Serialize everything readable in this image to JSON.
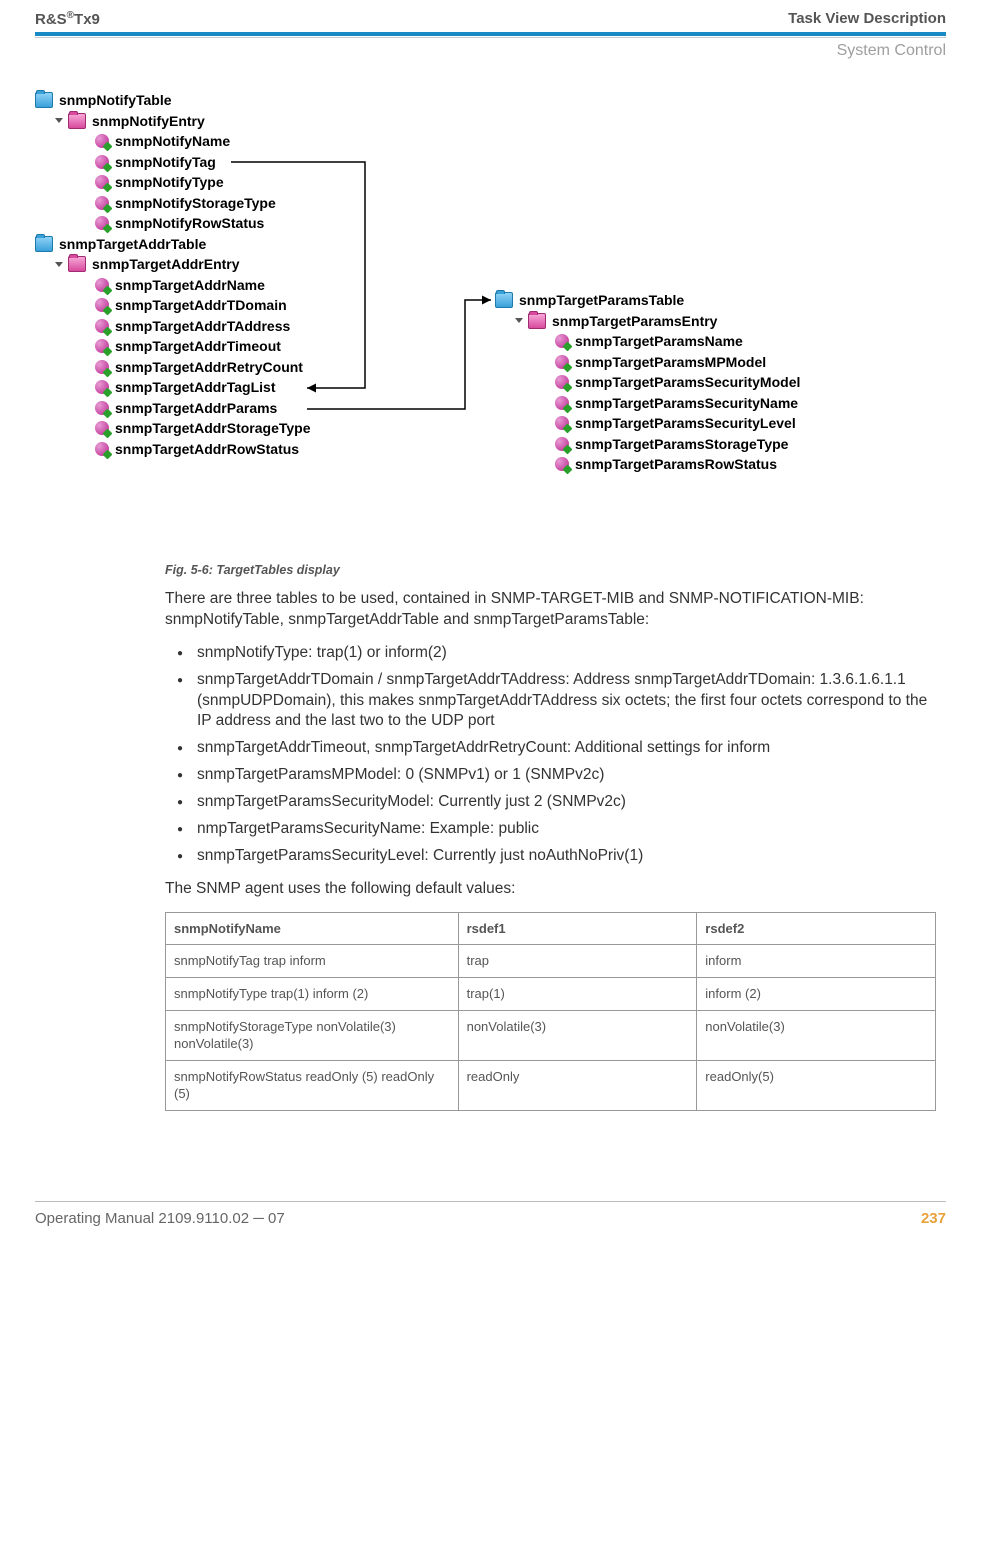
{
  "header": {
    "left_brand": "R&S",
    "left_sup": "®",
    "left_model": "Tx9",
    "right": "Task View Description",
    "sub": "System Control"
  },
  "diagram": {
    "left_tree": [
      {
        "level": 0,
        "icon": "folder-blue",
        "label": "snmpNotifyTable",
        "name": "snmpNotifyTable"
      },
      {
        "level": 1,
        "icon": "folder-pink",
        "label": "snmpNotifyEntry",
        "name": "snmpNotifyEntry",
        "expanded": true
      },
      {
        "level": 2,
        "icon": "leaf",
        "label": "snmpNotifyName",
        "name": "snmpNotifyName"
      },
      {
        "level": 2,
        "icon": "leaf",
        "label": "snmpNotifyTag",
        "name": "snmpNotifyTag"
      },
      {
        "level": 2,
        "icon": "leaf",
        "label": "snmpNotifyType",
        "name": "snmpNotifyType"
      },
      {
        "level": 2,
        "icon": "leaf",
        "label": "snmpNotifyStorageType",
        "name": "snmpNotifyStorageType"
      },
      {
        "level": 2,
        "icon": "leaf",
        "label": "snmpNotifyRowStatus",
        "name": "snmpNotifyRowStatus"
      },
      {
        "level": 0,
        "icon": "folder-blue",
        "label": "snmpTargetAddrTable",
        "name": "snmpTargetAddrTable"
      },
      {
        "level": 1,
        "icon": "folder-pink",
        "label": "snmpTargetAddrEntry",
        "name": "snmpTargetAddrEntry",
        "expanded": true
      },
      {
        "level": 2,
        "icon": "leaf",
        "label": "snmpTargetAddrName",
        "name": "snmpTargetAddrName"
      },
      {
        "level": 2,
        "icon": "leaf",
        "label": "snmpTargetAddrTDomain",
        "name": "snmpTargetAddrTDomain"
      },
      {
        "level": 2,
        "icon": "leaf",
        "label": "snmpTargetAddrTAddress",
        "name": "snmpTargetAddrTAddress"
      },
      {
        "level": 2,
        "icon": "leaf",
        "label": "snmpTargetAddrTimeout",
        "name": "snmpTargetAddrTimeout"
      },
      {
        "level": 2,
        "icon": "leaf",
        "label": "snmpTargetAddrRetryCount",
        "name": "snmpTargetAddrRetryCount"
      },
      {
        "level": 2,
        "icon": "leaf",
        "label": "snmpTargetAddrTagList",
        "name": "snmpTargetAddrTagList"
      },
      {
        "level": 2,
        "icon": "leaf",
        "label": "snmpTargetAddrParams",
        "name": "snmpTargetAddrParams"
      },
      {
        "level": 2,
        "icon": "leaf",
        "label": "snmpTargetAddrStorageType",
        "name": "snmpTargetAddrStorageType"
      },
      {
        "level": 2,
        "icon": "leaf",
        "label": "snmpTargetAddrRowStatus",
        "name": "snmpTargetAddrRowStatus"
      }
    ],
    "right_tree": [
      {
        "level": 0,
        "icon": "folder-blue",
        "label": "snmpTargetParamsTable",
        "name": "snmpTargetParamsTable"
      },
      {
        "level": 1,
        "icon": "folder-pink",
        "label": "snmpTargetParamsEntry",
        "name": "snmpTargetParamsEntry",
        "expanded": true
      },
      {
        "level": 2,
        "icon": "leaf",
        "label": "snmpTargetParamsName",
        "name": "snmpTargetParamsName"
      },
      {
        "level": 2,
        "icon": "leaf",
        "label": "snmpTargetParamsMPModel",
        "name": "snmpTargetParamsMPModel"
      },
      {
        "level": 2,
        "icon": "leaf",
        "label": "snmpTargetParamsSecurityModel",
        "name": "snmpTargetParamsSecurityModel"
      },
      {
        "level": 2,
        "icon": "leaf",
        "label": "snmpTargetParamsSecurityName",
        "name": "snmpTargetParamsSecurityName"
      },
      {
        "level": 2,
        "icon": "leaf",
        "label": "snmpTargetParamsSecurityLevel",
        "name": "snmpTargetParamsSecurityLevel"
      },
      {
        "level": 2,
        "icon": "leaf",
        "label": "snmpTargetParamsStorageType",
        "name": "snmpTargetParamsStorageType"
      },
      {
        "level": 2,
        "icon": "leaf",
        "label": "snmpTargetParamsRowStatus",
        "name": "snmpTargetParamsRowStatus"
      }
    ]
  },
  "caption": "Fig. 5-6: TargetTables display",
  "para1": "There are three tables to be used, contained in SNMP-TARGET-MIB and SNMP-NOTIFICATION-MIB: snmpNotifyTable, snmpTargetAddrTable and snmpTargetParamsTable:",
  "bullets": [
    "snmpNotifyType: trap(1) or inform(2)",
    "snmpTargetAddrTDomain / snmpTargetAddrTAddress: Address snmpTargetAddrTDomain: 1.3.6.1.6.1.1 (snmpUDPDomain), this makes snmpTargetAddrTAddress six octets; the first four octets correspond to the IP address and the last two to the UDP port",
    "snmpTargetAddrTimeout, snmpTargetAddrRetryCount: Additional settings for inform",
    "snmpTargetParamsMPModel: 0 (SNMPv1) or 1 (SNMPv2c)",
    "snmpTargetParamsSecurityModel: Currently just 2 (SNMPv2c)",
    "nmpTargetParamsSecurityName: Example: public",
    "snmpTargetParamsSecurityLevel: Currently just noAuthNoPriv(1)"
  ],
  "para2": "The SNMP agent uses the following default values:",
  "table": {
    "headers": [
      "snmpNotifyName",
      "rsdef1",
      "rsdef2"
    ],
    "rows": [
      [
        "snmpNotifyTag trap inform",
        "trap",
        "inform"
      ],
      [
        "snmpNotifyType trap(1) inform (2)",
        "trap(1)",
        "inform (2)"
      ],
      [
        "snmpNotifyStorageType nonVolatile(3) nonVolatile(3)",
        "nonVolatile(3)",
        "nonVolatile(3)"
      ],
      [
        "snmpNotifyRowStatus readOnly (5) readOnly (5)",
        "readOnly",
        "readOnly(5)"
      ]
    ]
  },
  "footer": {
    "left": "Operating Manual 2109.9110.02 ─ 07",
    "page": "237"
  }
}
